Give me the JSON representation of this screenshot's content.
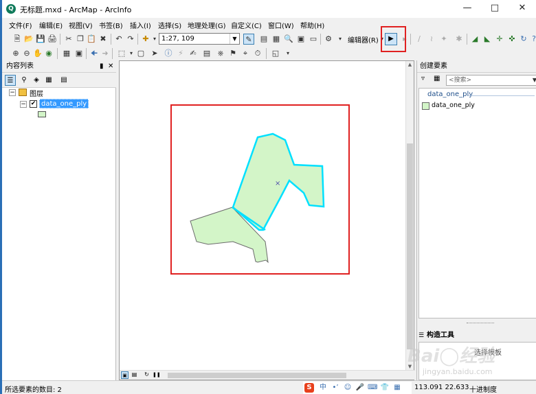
{
  "window": {
    "title": "无标题.mxd - ArcMap - ArcInfo",
    "app_icon": "globe-icon",
    "controls": [
      "minimize-icon",
      "maximize-icon",
      "close-icon"
    ]
  },
  "menu": {
    "items": [
      "文件(F)",
      "编辑(E)",
      "视图(V)",
      "书签(B)",
      "插入(I)",
      "选择(S)",
      "地理处理(G)",
      "自定义(C)",
      "窗口(W)",
      "帮助(H)"
    ]
  },
  "toolbar": {
    "scale": "1:27, 109",
    "editor_label": "编辑器(R)",
    "edit_tool_icon": "arrow-cursor-icon"
  },
  "toc": {
    "title": "内容列表",
    "root_label": "图层",
    "layer_name": "data_one_ply",
    "layer_checked": true,
    "symbol_color": "#d3f5c8"
  },
  "map": {
    "frame_color": "#e02020",
    "selected_outline_color": "#00e0ff",
    "fill_color": "#d3f5c8"
  },
  "create_features": {
    "title": "创建要素",
    "search_placeholder": "<搜索>",
    "group_name": "data_one_ply",
    "template_name": "data_one_ply",
    "construct_title": "构造工具",
    "construct_placeholder": "选择模板"
  },
  "status": {
    "selection_text": "所选要素的数目: 2",
    "coordinates": "113.091  22.633",
    "units": "十进制度"
  },
  "watermark": "Baidu经验 jingyan.baidu.com"
}
